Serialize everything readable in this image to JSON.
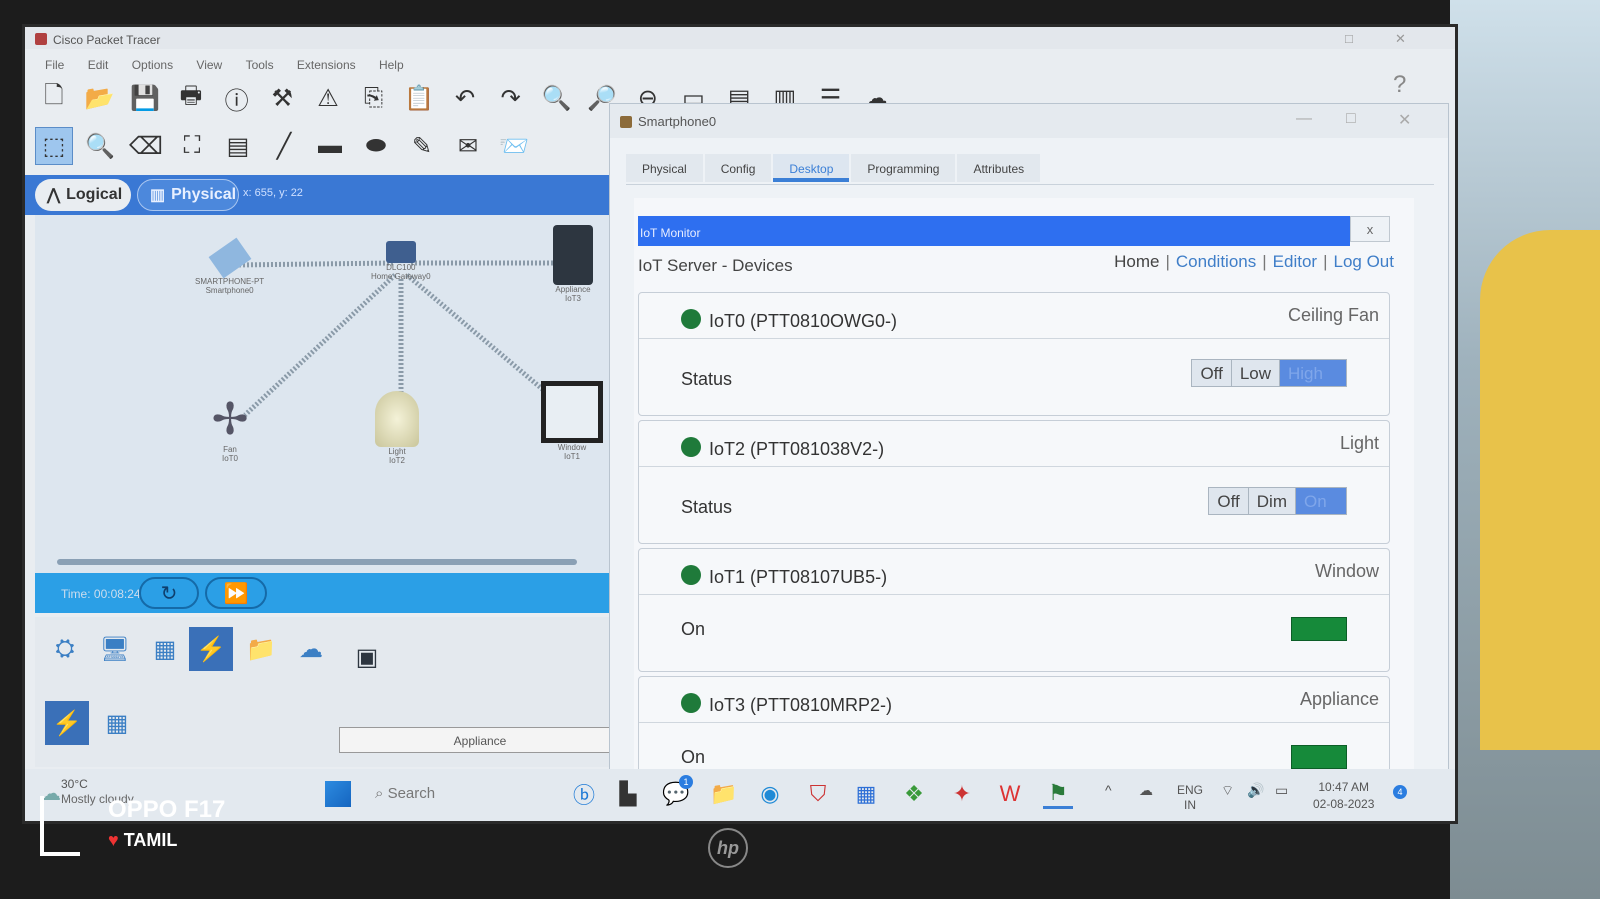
{
  "app": {
    "title": "Cisco Packet Tracer"
  },
  "menu": [
    "File",
    "Edit",
    "Options",
    "View",
    "Tools",
    "Extensions",
    "Help"
  ],
  "mode": {
    "logical": "Logical",
    "physical": "Physical",
    "coords": "x: 655, y: 22"
  },
  "canvas_devices": [
    {
      "label": "SMARTPHONE-PT\nSmartphone0"
    },
    {
      "label": "DLC100\nHome Gateway0"
    },
    {
      "label": "Appliance\nIoT3"
    },
    {
      "label": "Fan\nIoT0"
    },
    {
      "label": "Light\nIoT2"
    },
    {
      "label": "Window\nIoT1"
    }
  ],
  "sim": {
    "time": "Time: 00:08:24"
  },
  "palette": {
    "selected_label": "Appliance"
  },
  "phone": {
    "title": "Smartphone0",
    "tabs": [
      "Physical",
      "Config",
      "Desktop",
      "Programming",
      "Attributes"
    ],
    "active_tab": "Desktop",
    "app_title": "IoT Monitor",
    "close": "x",
    "server_title": "IoT Server - Devices",
    "nav": {
      "home": "Home",
      "conditions": "Conditions",
      "editor": "Editor",
      "logout": "Log Out"
    },
    "devices": [
      {
        "name": "IoT0 (PTT0810OWG0-)",
        "type": "Ceiling Fan",
        "status_label": "Status",
        "options": [
          "Off",
          "Low",
          "High"
        ],
        "selected": "High"
      },
      {
        "name": "IoT2 (PTT081038V2-)",
        "type": "Light",
        "status_label": "Status",
        "options": [
          "Off",
          "Dim",
          "On"
        ],
        "selected": "On"
      },
      {
        "name": "IoT1 (PTT08107UB5-)",
        "type": "Window",
        "status_label": "On",
        "toggle": true
      },
      {
        "name": "IoT3 (PTT0810MRP2-)",
        "type": "Appliance",
        "status_label": "On",
        "toggle": true
      }
    ],
    "status_color": "#1f7a3a",
    "toggle_color": "#168a3a"
  },
  "taskbar": {
    "weather_temp": "30°C",
    "weather_desc": "Mostly cloudy",
    "search": "Search",
    "lang1": "ENG",
    "lang2": "IN",
    "time": "10:47 AM",
    "date": "02-08-2023",
    "chat_badge": "1",
    "notif_badge": "4"
  },
  "watermark": {
    "brand": "OPPO F17",
    "tag": "TAMIL"
  },
  "laptop_logo": "hp"
}
